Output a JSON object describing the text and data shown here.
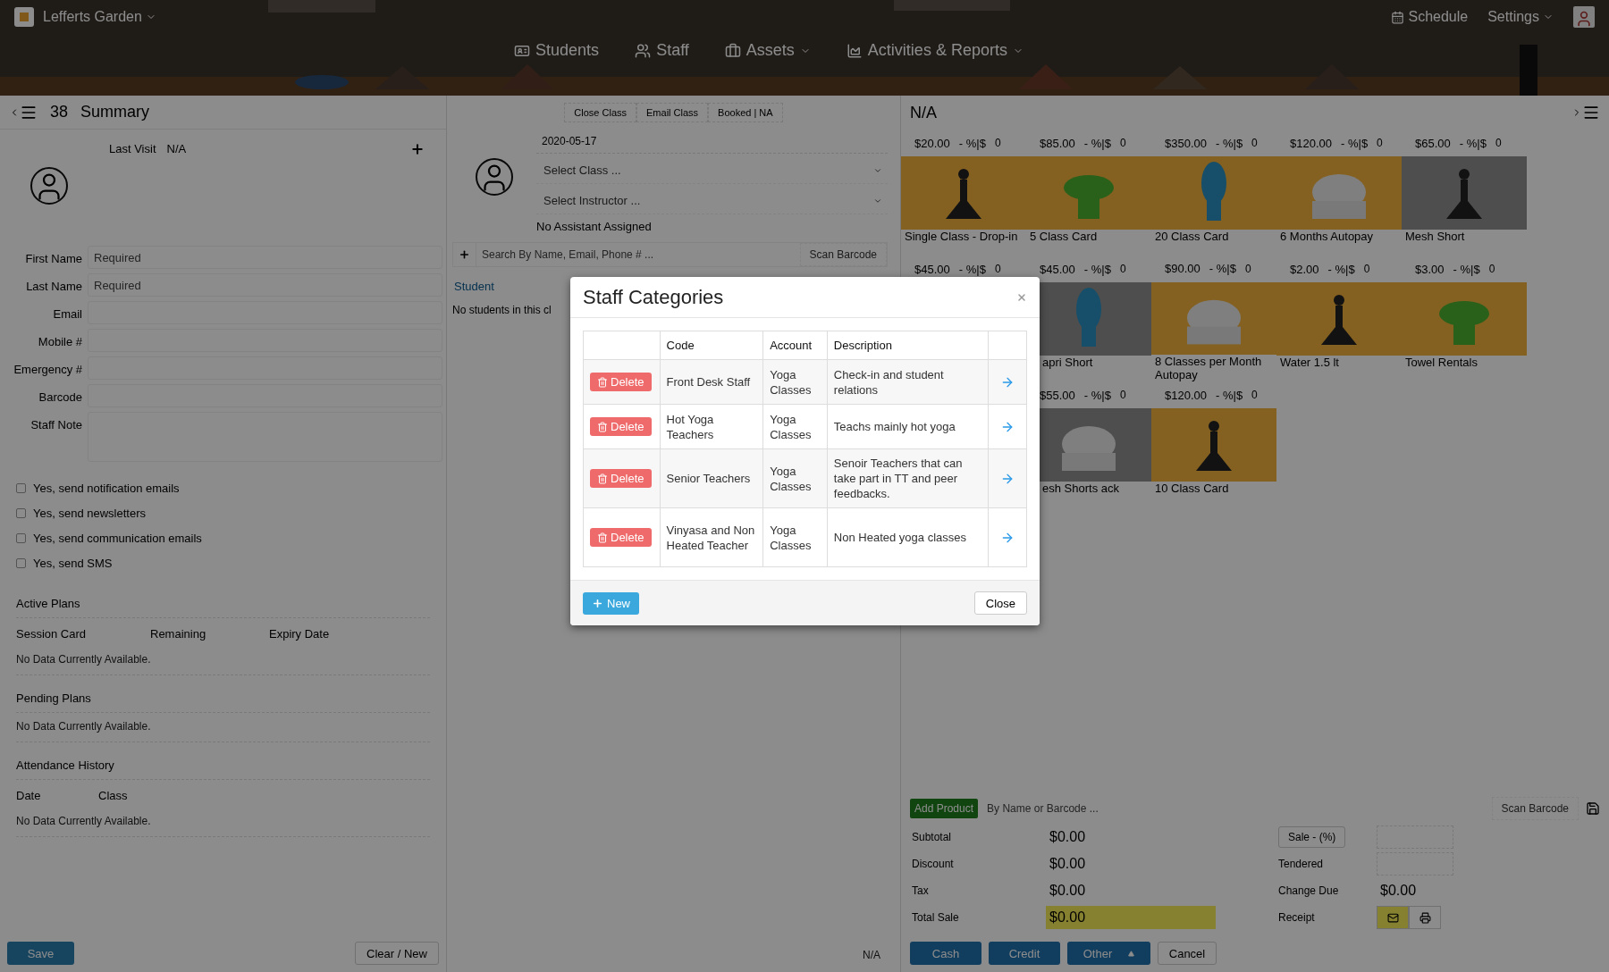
{
  "header": {
    "studio": "Lefferts Garden",
    "nav": [
      {
        "label": "Students",
        "dropdown": false
      },
      {
        "label": "Staff",
        "dropdown": false
      },
      {
        "label": "Assets",
        "dropdown": true
      },
      {
        "label": "Activities & Reports",
        "dropdown": true
      }
    ],
    "schedule": "Schedule",
    "settings": "Settings"
  },
  "summary": {
    "count": "38",
    "title": "Summary",
    "last_visit_label": "Last Visit",
    "last_visit": "N/A",
    "fields": [
      {
        "label": "First Name",
        "placeholder": "Required",
        "kind": "input"
      },
      {
        "label": "Last Name",
        "placeholder": "Required",
        "kind": "input"
      },
      {
        "label": "Email",
        "kind": "input"
      },
      {
        "label": "Mobile #",
        "kind": "input"
      },
      {
        "label": "Emergency #",
        "kind": "input"
      },
      {
        "label": "Barcode",
        "kind": "input"
      },
      {
        "label": "Staff Note",
        "kind": "textarea"
      }
    ],
    "checkboxes": [
      {
        "label": "Yes, send notification emails",
        "checked": false
      },
      {
        "label": "Yes, send newsletters",
        "checked": false
      },
      {
        "label": "Yes, send communication emails",
        "checked": false
      },
      {
        "label": "Yes, send SMS",
        "checked": false
      }
    ],
    "sections": [
      {
        "title": "Active Plans",
        "columns": [
          "Session Card",
          "Remaining",
          "Expiry Date"
        ],
        "empty": "No Data Currently Available."
      },
      {
        "title": "Pending Plans",
        "empty": "No Data Currently Available."
      },
      {
        "title": "Attendance History",
        "columns": [
          "Date",
          "Class"
        ],
        "empty": "No Data Currently Available."
      }
    ],
    "save": "Save",
    "clear": "Clear / New"
  },
  "class_panel": {
    "buttons": [
      "Close Class",
      "Email Class",
      "Booked | NA"
    ],
    "date": "2020-05-17",
    "selects": [
      {
        "placeholder": "Select Class ..."
      },
      {
        "placeholder": "Select Instructor ..."
      }
    ],
    "assistant": "No Assistant Assigned",
    "search_placeholder": "Search By Name, Email, Phone # ...",
    "scan": "Scan Barcode",
    "student_heading": "Student",
    "empty": "No students in this cl",
    "footer": "N/A"
  },
  "pos": {
    "title": "N/A",
    "products": [
      {
        "price": "$20.00",
        "discount": "- %|$",
        "qty": "0",
        "name": "Single Class - Drop-in",
        "kind": "card"
      },
      {
        "price": "$85.00",
        "discount": "- %|$",
        "qty": "0",
        "name": "5 Class Card",
        "kind": "card"
      },
      {
        "price": "$350.00",
        "discount": "- %|$",
        "qty": "0",
        "name": "20 Class Card",
        "kind": "card"
      },
      {
        "price": "$120.00",
        "discount": "- %|$",
        "qty": "0",
        "name": "6 Months Autopay",
        "kind": "card"
      },
      {
        "price": "$65.00",
        "discount": "- %|$",
        "qty": "0",
        "name": "Mesh Short",
        "kind": "card"
      },
      {
        "price": "$45.00",
        "discount": "- %|$",
        "qty": "0",
        "kind": "covered"
      },
      {
        "price": "$45.00",
        "discount": "- %|$",
        "qty": "0",
        "name": "apri Short",
        "kind": "clipped"
      },
      {
        "price": "$90.00",
        "discount": "- %|$",
        "qty": "0",
        "name": "8 Classes per Month Autopay",
        "kind": "card"
      },
      {
        "price": "$2.00",
        "discount": "- %|$",
        "qty": "0",
        "name": "Water 1.5 lt",
        "kind": "card"
      },
      {
        "price": "$3.00",
        "discount": "- %|$",
        "qty": "0",
        "name": "Towel Rentals",
        "kind": "card"
      },
      {
        "kind": "empty"
      },
      {
        "price": "$55.00",
        "discount": "- %|$",
        "qty": "0",
        "name": "esh Shorts ack",
        "kind": "clipped"
      },
      {
        "price": "$120.00",
        "discount": "- %|$",
        "qty": "0",
        "name": "10 Class Card",
        "kind": "card"
      }
    ],
    "add_product": "Add Product",
    "search_placeholder": "By Name or Barcode ...",
    "scan": "Scan Barcode",
    "totals": [
      {
        "label": "Subtotal",
        "value": "$0.00",
        "highlight": false
      },
      {
        "label": "Discount",
        "value": "$0.00",
        "highlight": false
      },
      {
        "label": "Tax",
        "value": "$0.00",
        "highlight": false
      },
      {
        "label": "Total Sale",
        "value": "$0.00",
        "highlight": true
      }
    ],
    "sale_button": "Sale - (%)",
    "tendered": "Tendered",
    "change_due_label": "Change Due",
    "change_due": "$0.00",
    "receipt": "Receipt",
    "pay_buttons": [
      {
        "label": "Cash",
        "kind": "primary"
      },
      {
        "label": "Credit",
        "kind": "primary"
      },
      {
        "label": "Other",
        "kind": "split"
      },
      {
        "label": "Cancel",
        "kind": "plain"
      }
    ]
  },
  "modal": {
    "title": "Staff Categories",
    "columns": [
      "Code",
      "Account",
      "Description"
    ],
    "rows": [
      {
        "code": "Front Desk Staff",
        "account": "Yoga Classes",
        "description": "Check-in and student relations",
        "action": "Delete"
      },
      {
        "code": "Hot Yoga Teachers",
        "account": "Yoga Classes",
        "description": "Teachs mainly hot yoga",
        "action": "Delete"
      },
      {
        "code": "Senior Teachers",
        "account": "Yoga Classes",
        "description": "Senoir Teachers that can take part in TT and peer feedbacks.",
        "action": "Delete"
      },
      {
        "code": "Vinyasa and Non Heated Teacher",
        "account": "Yoga Classes",
        "description": "Non Heated yoga classes",
        "action": "Delete"
      }
    ],
    "new": "New",
    "close": "Close"
  }
}
